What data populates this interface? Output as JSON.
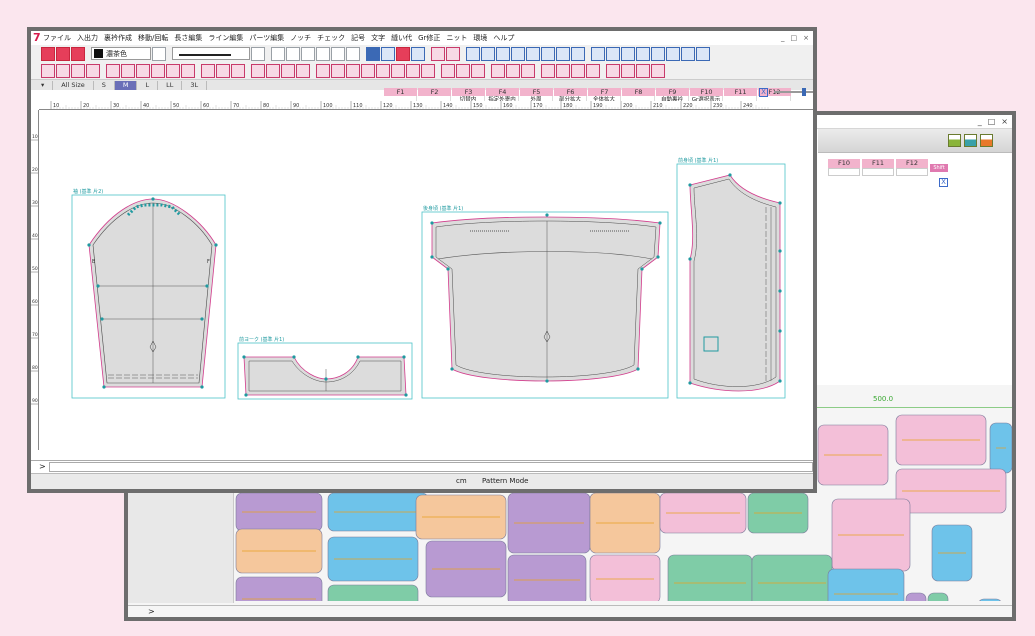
{
  "front": {
    "menu": [
      "ファイル",
      "入出力",
      "裏衿作成",
      "移動/回転",
      "長さ編集",
      "ライン編集",
      "パーツ編集",
      "ノッチ",
      "チェック",
      "記号",
      "文字",
      "縫い代",
      "Gr修正",
      "ニット",
      "環境",
      "ヘルプ"
    ],
    "window_buttons": [
      "_",
      "□",
      "×"
    ],
    "color_select": "濃茶色",
    "size_tabs": [
      "All Size",
      "S",
      "M",
      "L",
      "LL",
      "3L"
    ],
    "active_size": "M",
    "fkeys": [
      {
        "label": "F1",
        "value": ""
      },
      {
        "label": "F2",
        "value": ""
      },
      {
        "label": "F3",
        "value": "切替内"
      },
      {
        "label": "F4",
        "value": "指定外寄内"
      },
      {
        "label": "F5",
        "value": "外周"
      },
      {
        "label": "F6",
        "value": "部分拡大"
      },
      {
        "label": "F7",
        "value": "全体拡大"
      },
      {
        "label": "F8",
        "value": ""
      },
      {
        "label": "F9",
        "value": "自動裏衿"
      },
      {
        "label": "F10",
        "value": "Gr選択表示"
      },
      {
        "label": "F11",
        "value": ""
      },
      {
        "label": "F12",
        "value": ""
      }
    ],
    "close_x": "X",
    "ruler_ticks": [
      "10",
      "20",
      "30",
      "40",
      "50",
      "60",
      "70",
      "80",
      "90",
      "100",
      "110",
      "120",
      "130",
      "140",
      "150",
      "160",
      "170",
      "180",
      "190",
      "200",
      "210",
      "220",
      "230",
      "240"
    ],
    "vruler_ticks": [
      "10",
      "20",
      "30",
      "40",
      "50",
      "60",
      "70",
      "80",
      "90"
    ],
    "pieces": {
      "sleeve": "袖 (基準 片2)",
      "yoke": "前ヨーク (基準 片1)",
      "back": "後身頃 (基準 片1)",
      "front": "前身頃 (基準 片1)"
    },
    "piece_letters": {
      "b": "B",
      "f": "F"
    },
    "command_prompt": ">",
    "status_unit": "cm",
    "status_mode": "Pattern Mode"
  },
  "back": {
    "window_buttons": [
      "_",
      "□",
      "×"
    ],
    "fkeys": [
      "F10",
      "F11",
      "F12"
    ],
    "shift_label": "Shift",
    "close_x": "X",
    "marker_width_label": "500.0",
    "command_prompt": ">"
  },
  "colors": {
    "pattern_fill": "#dcdcdc",
    "piece_frame": "#4cc3c8",
    "seam_line": "#d23c8c",
    "point": "#1f9aa0",
    "marker_pink": "#f3bfd8",
    "marker_blue": "#6ec3ea",
    "marker_purple": "#b89ad2",
    "marker_green": "#7fcca7",
    "marker_orange": "#f5c79c"
  }
}
